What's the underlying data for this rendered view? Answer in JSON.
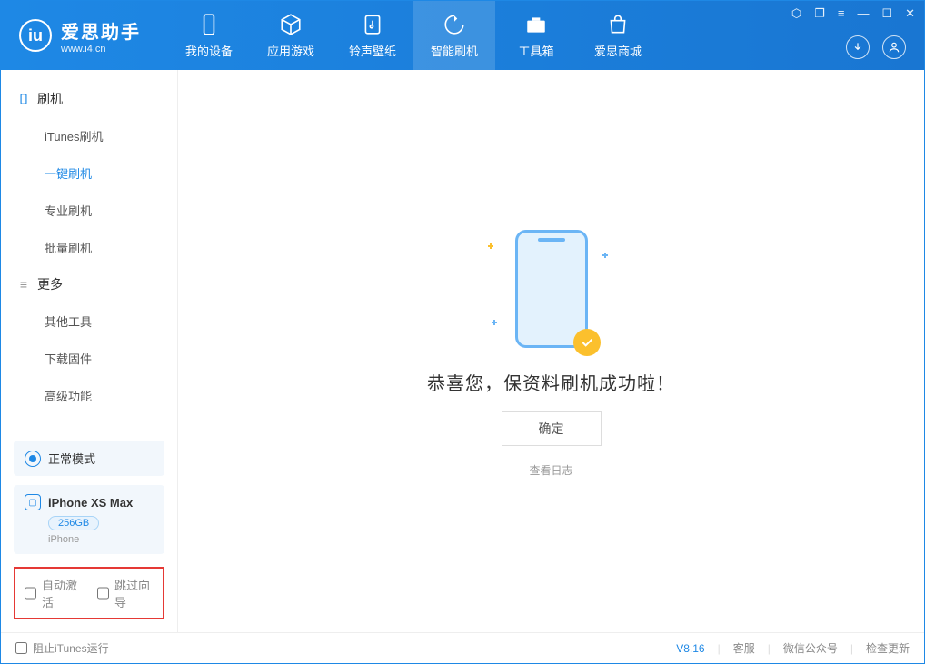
{
  "app": {
    "title": "爱思助手",
    "subtitle": "www.i4.cn"
  },
  "nav": {
    "items": [
      {
        "label": "我的设备"
      },
      {
        "label": "应用游戏"
      },
      {
        "label": "铃声壁纸"
      },
      {
        "label": "智能刷机"
      },
      {
        "label": "工具箱"
      },
      {
        "label": "爱思商城"
      }
    ]
  },
  "sidebar": {
    "group1": {
      "title": "刷机"
    },
    "items1": [
      {
        "label": "iTunes刷机"
      },
      {
        "label": "一键刷机"
      },
      {
        "label": "专业刷机"
      },
      {
        "label": "批量刷机"
      }
    ],
    "group2": {
      "title": "更多"
    },
    "items2": [
      {
        "label": "其他工具"
      },
      {
        "label": "下载固件"
      },
      {
        "label": "高级功能"
      }
    ],
    "mode": "正常模式",
    "device": {
      "name": "iPhone XS Max",
      "capacity": "256GB",
      "type": "iPhone"
    },
    "checkboxes": {
      "auto_activate": "自动激活",
      "skip_guide": "跳过向导"
    }
  },
  "main": {
    "success_message": "恭喜您，保资料刷机成功啦！",
    "ok_button": "确定",
    "view_log": "查看日志"
  },
  "footer": {
    "block_itunes": "阻止iTunes运行",
    "version": "V8.16",
    "links": {
      "service": "客服",
      "wechat": "微信公众号",
      "update": "检查更新"
    }
  }
}
